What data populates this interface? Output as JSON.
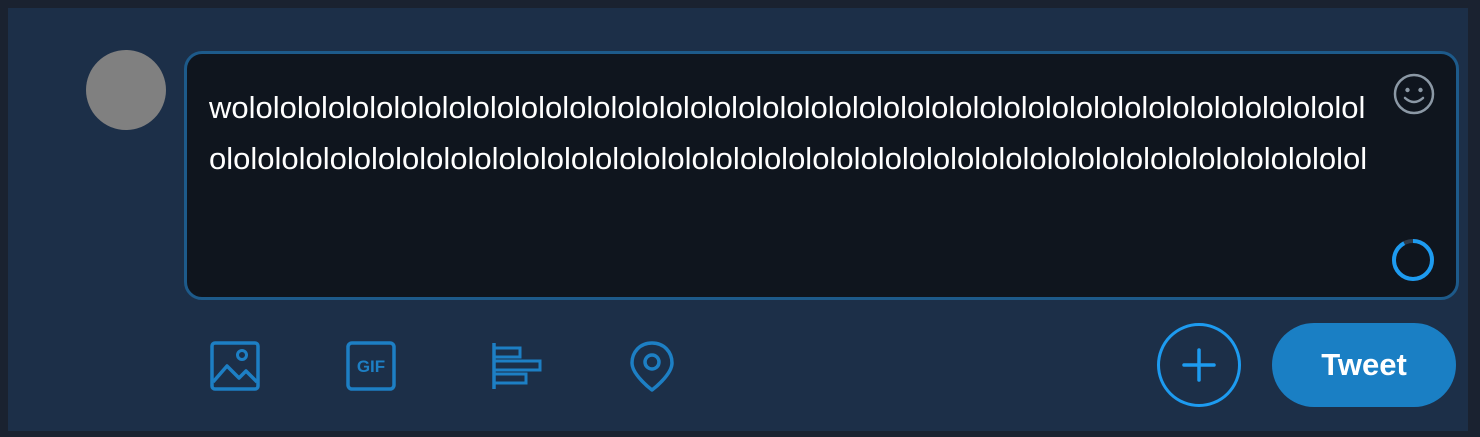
{
  "composer": {
    "text": "wololololololololololololololololololololololololololololololololololololololololololololololololololololololololololololololololololololololololololololololololololololololololololololololol"
  },
  "toolbar": {
    "icons": [
      "image-icon",
      "gif-icon",
      "poll-icon",
      "location-icon"
    ],
    "gif_label": "GIF",
    "tweet_label": "Tweet"
  },
  "colors": {
    "accent": "#1d9bf0",
    "tweet_button": "#1a7fc4",
    "composer_border": "#1d5a8a",
    "composer_bg": "#0f151e",
    "panel_bg": "#1c2f48",
    "avatar": "#808080"
  }
}
